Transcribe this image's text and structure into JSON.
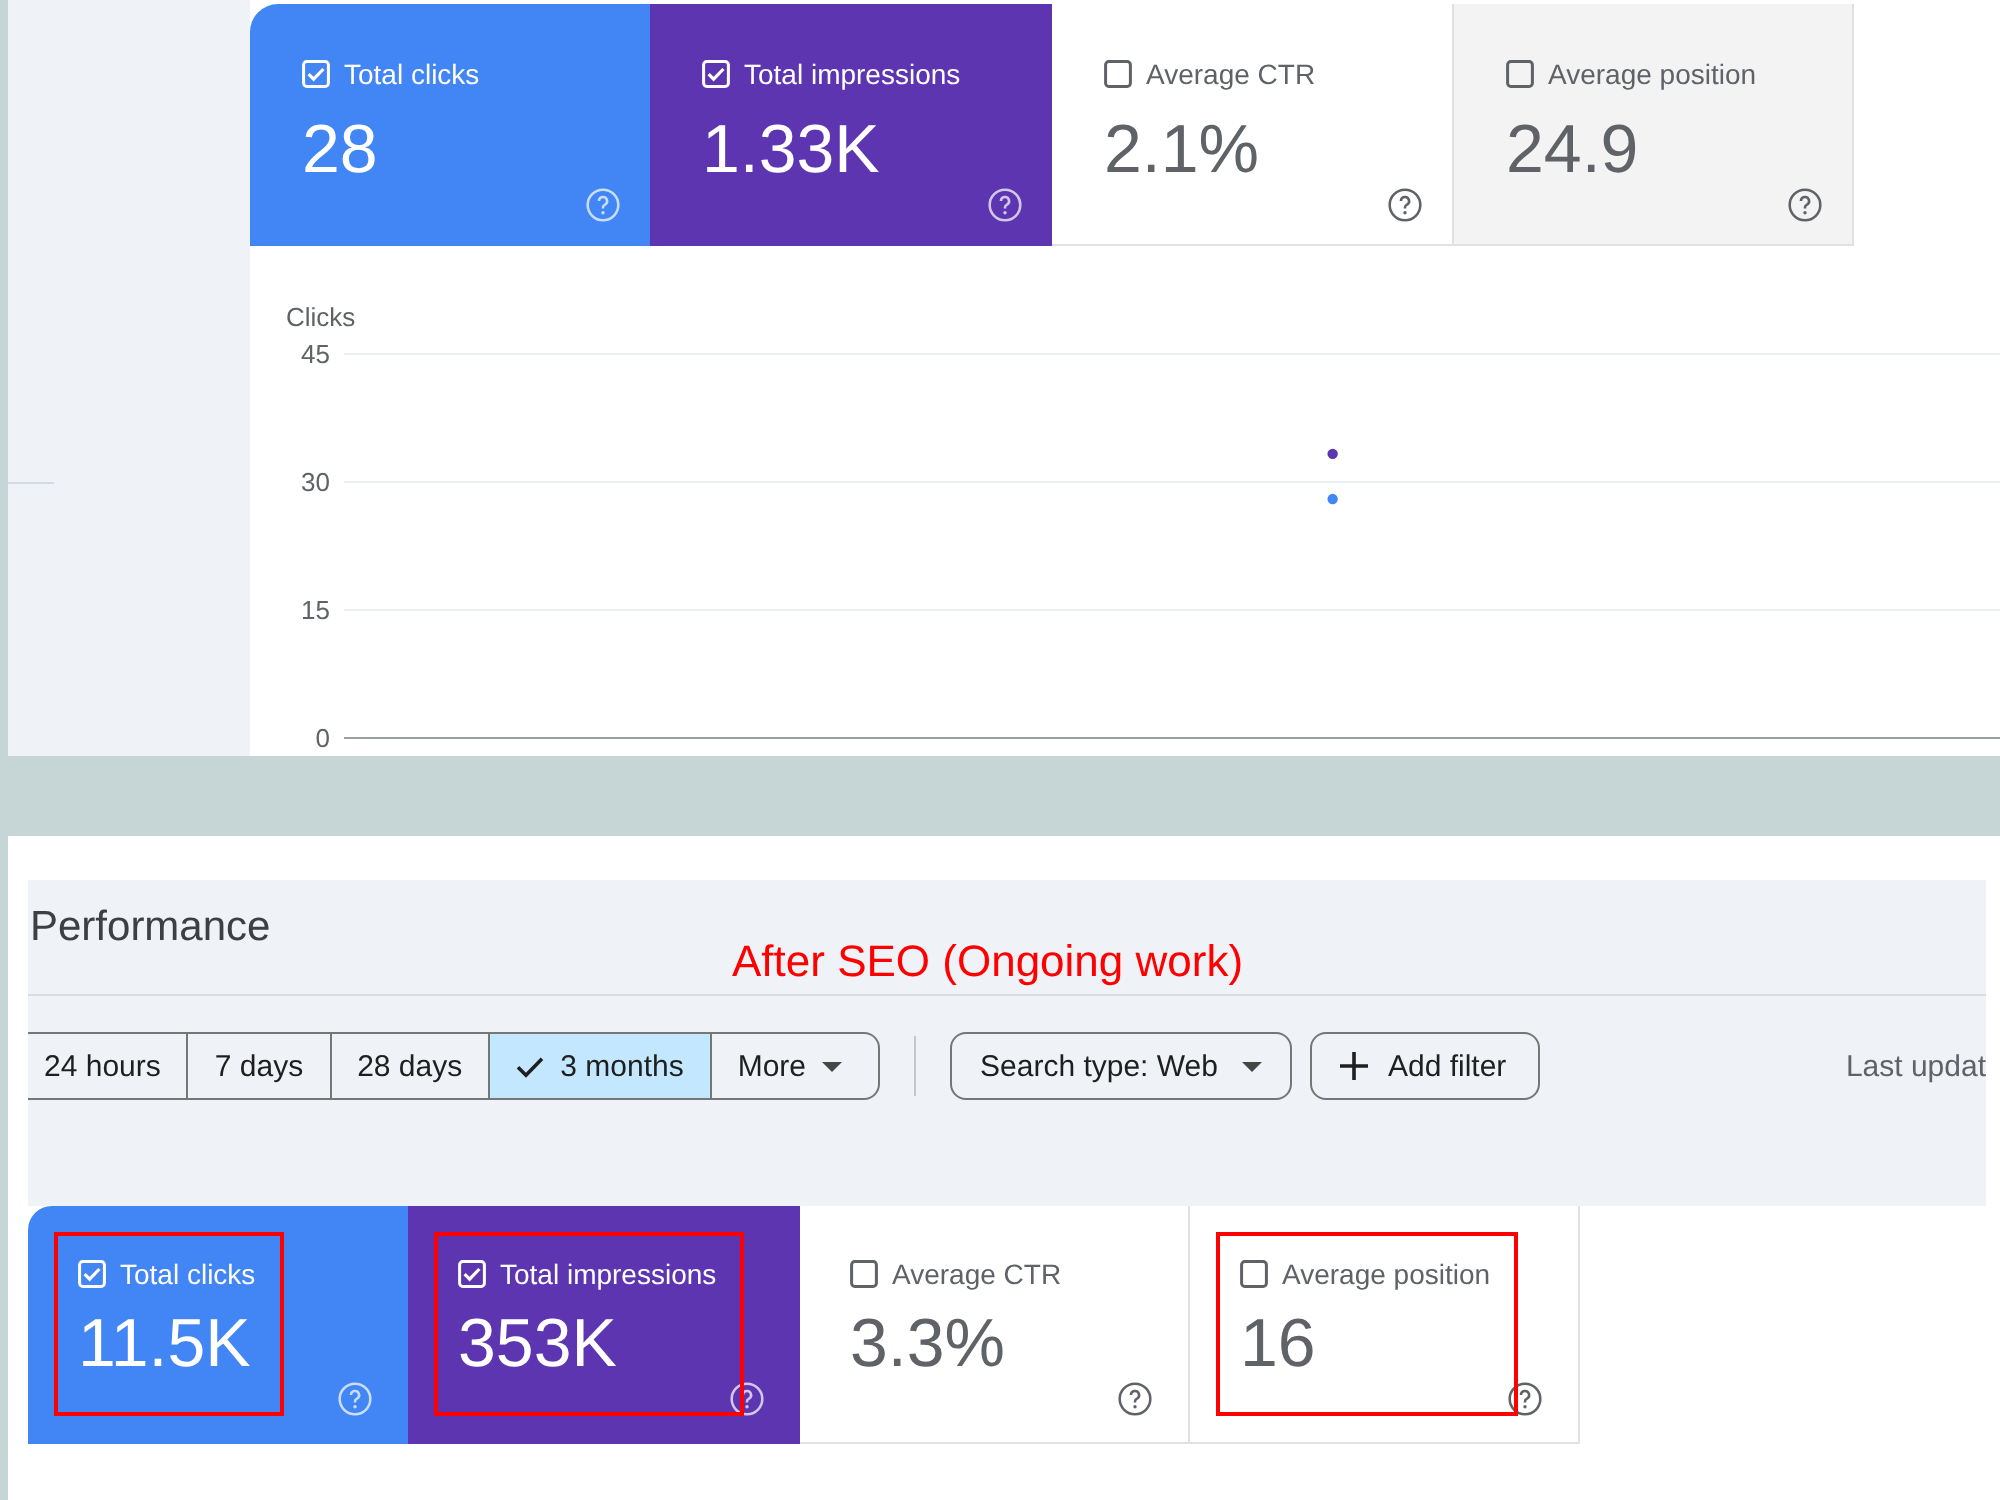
{
  "before": {
    "metrics": [
      {
        "label": "Total clicks",
        "value": "28",
        "checked": true,
        "hovered": false,
        "color": "#4285f4"
      },
      {
        "label": "Total impressions",
        "value": "1.33K",
        "checked": true,
        "hovered": false,
        "color": "#5e35b1"
      },
      {
        "label": "Average CTR",
        "value": "2.1%",
        "checked": false,
        "hovered": false
      },
      {
        "label": "Average position",
        "value": "24.9",
        "checked": false,
        "hovered": true
      }
    ],
    "chart": {
      "chart_data": {
        "type": "scatter",
        "ylabel": "Clicks",
        "ylim": [
          0,
          45
        ],
        "yticks": [
          0,
          15,
          30,
          45
        ],
        "series": [
          {
            "color": "#5e35b1",
            "values": [
              33.3
            ]
          },
          {
            "color": "#4285f4",
            "values": [
              28
            ]
          }
        ]
      }
    }
  },
  "after": {
    "title": "Performance",
    "annotation": "After SEO (Ongoing work)",
    "date_ranges": [
      {
        "label": "24 hours",
        "kind": "range",
        "selected": false
      },
      {
        "label": "7 days",
        "kind": "range",
        "selected": false
      },
      {
        "label": "28 days",
        "kind": "range",
        "selected": false
      },
      {
        "label": "3 months",
        "kind": "range",
        "selected": true
      },
      {
        "label": "More",
        "kind": "menu",
        "selected": false
      }
    ],
    "filters": [
      {
        "label": "Search type: Web",
        "kind": "dropdown"
      },
      {
        "label": "Add filter",
        "kind": "add"
      }
    ],
    "last_updated": "Last updat",
    "metrics": [
      {
        "label": "Total clicks",
        "value": "11.5K",
        "checked": true,
        "highlighted": true,
        "color": "#4285f4"
      },
      {
        "label": "Total impressions",
        "value": "353K",
        "checked": true,
        "highlighted": true,
        "color": "#5e35b1"
      },
      {
        "label": "Average CTR",
        "value": "3.3%",
        "checked": false,
        "highlighted": false
      },
      {
        "label": "Average position",
        "value": "16",
        "checked": false,
        "highlighted": true
      }
    ]
  }
}
